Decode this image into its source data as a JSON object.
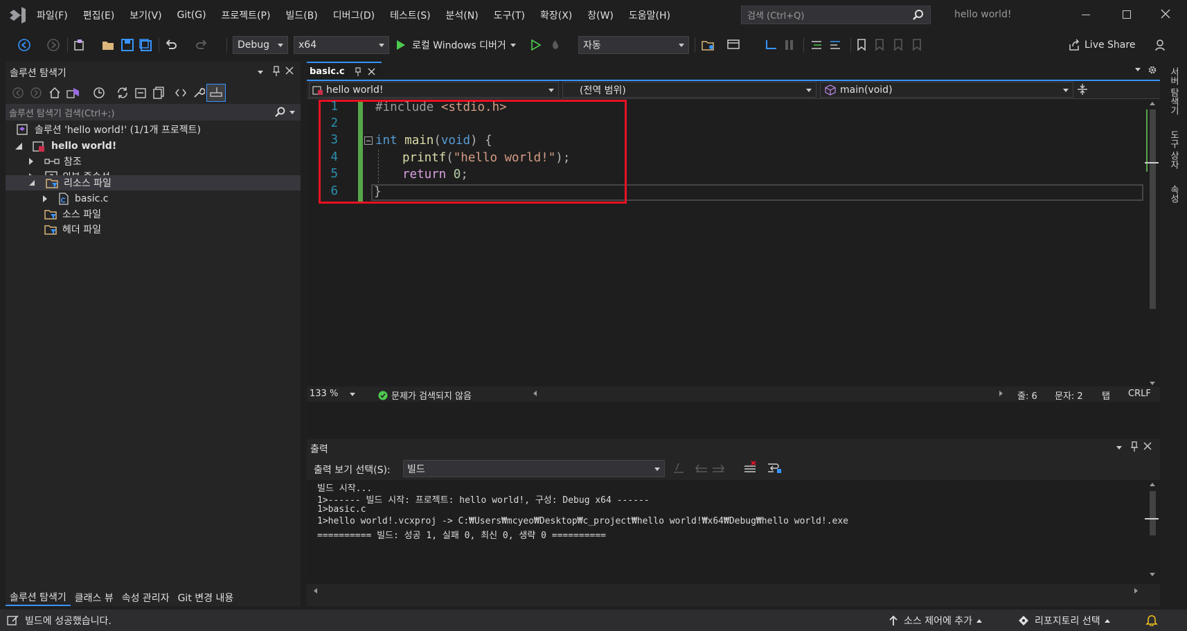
{
  "app": {
    "logo": "visual-studio-logo",
    "window_title": "hello world!"
  },
  "menu": [
    "파일(F)",
    "편집(E)",
    "보기(V)",
    "Git(G)",
    "프로젝트(P)",
    "빌드(B)",
    "디버그(D)",
    "테스트(S)",
    "분석(N)",
    "도구(T)",
    "확장(X)",
    "창(W)",
    "도움말(H)"
  ],
  "search": {
    "placeholder": "검색 (Ctrl+Q)"
  },
  "toolbar": {
    "config": "Debug",
    "platform": "x64",
    "run_label": "로컬 Windows 디버거",
    "target": "자동",
    "live_share": "Live Share"
  },
  "solution_explorer": {
    "title": "솔루션 탐색기",
    "search_placeholder": "솔루션 탐색기 검색(Ctrl+;)",
    "tree": {
      "solution": "솔루션 'hello world!' (1/1개 프로젝트)",
      "project": "hello world!",
      "references": "참조",
      "external": "외부 종속성",
      "resource": "리소스 파일",
      "file": "basic.c",
      "source": "소스 파일",
      "header": "헤더 파일"
    },
    "bottom_tabs": [
      "솔루션 탐색기",
      "클래스 뷰",
      "속성 관리자",
      "Git 변경 내용"
    ]
  },
  "editor": {
    "tab": "basic.c",
    "nav_project": "hello world!",
    "nav_scope": "(전역 범위)",
    "nav_member": "main(void)",
    "line_numbers": [
      "1",
      "2",
      "3",
      "4",
      "5",
      "6"
    ],
    "code": {
      "l1_directive": "#include",
      "l1_header": "<stdio.h>",
      "l3_type": "int",
      "l3_name": "main",
      "l3_open": "(",
      "l3_void": "void",
      "l3_close": ") {",
      "l4_func": "printf",
      "l4_open": "(",
      "l4_string": "\"hello world!\"",
      "l4_close": ");",
      "l5_kw": "return",
      "l5_num": "0",
      "l5_semi": ";",
      "l6_brace": "}"
    },
    "zoom": "133 %",
    "issues": "문제가 검색되지 않음",
    "line_info": "줄: 6",
    "char_info": "문자: 2",
    "indent": "탭",
    "eol": "CRLF"
  },
  "right_tabs": [
    "서버 탐색기",
    "도구 상자",
    "속성"
  ],
  "output": {
    "title": "출력",
    "source_label": "출력 보기 선택(S):",
    "source_value": "빌드",
    "lines": [
      "빌드 시작...",
      "1>------ 빌드 시작: 프로젝트: hello world!, 구성: Debug x64 ------",
      "1>basic.c",
      "1>hello world!.vcxproj -> C:₩Users₩mcyeo₩Desktop₩c_project₩hello world!₩x64₩Debug₩hello world!.exe",
      "========== 빌드: 성공 1, 실패 0, 최신 0, 생략 0 =========="
    ]
  },
  "status": {
    "message": "빌드에 성공했습니다.",
    "add_source_control": "소스 제어에 추가",
    "select_repo": "리포지토리 선택"
  },
  "colors": {
    "accent": "#007acc",
    "highlight_box": "#e81123",
    "changed_margin": "#57a64a",
    "keyword": "#569cd6",
    "string": "#d69d85"
  }
}
